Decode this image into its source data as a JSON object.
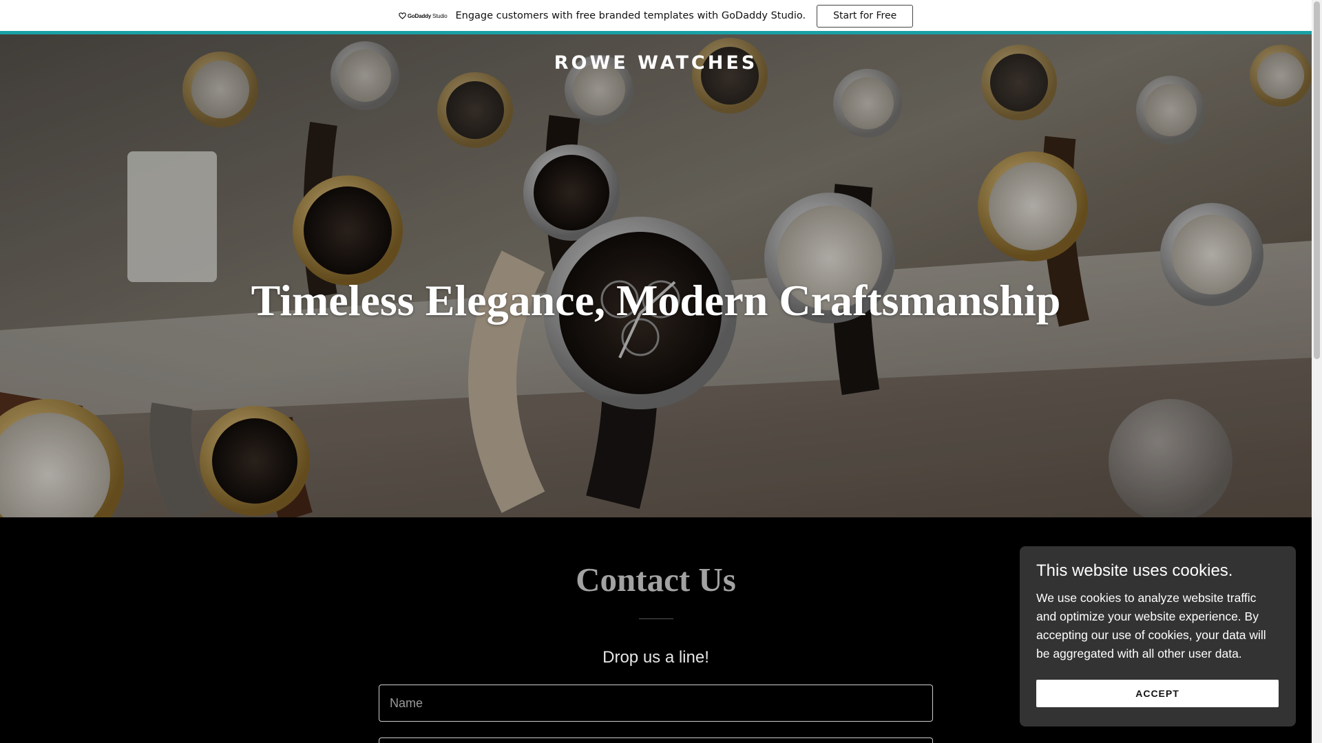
{
  "promo": {
    "logo_brand": "GoDaddy",
    "logo_product": "Studio",
    "text": "Engage customers with free branded templates with GoDaddy Studio.",
    "button_label": "Start for Free",
    "accent_color": "#1aa0a4"
  },
  "hero": {
    "site_title": "ROWE WATCHES",
    "heading": "Timeless Elegance, Modern Craftsmanship",
    "background_image": "watches displayed on white stands in a glass case"
  },
  "contact": {
    "title": "Contact Us",
    "subtitle": "Drop us a line!",
    "name_placeholder": "Name"
  },
  "cookie_banner": {
    "title": "This website uses cookies.",
    "body": "We use cookies to analyze website traffic and optimize your website experience. By accepting our use of cookies, your data will be aggregated with all other user data.",
    "accept_label": "ACCEPT"
  }
}
